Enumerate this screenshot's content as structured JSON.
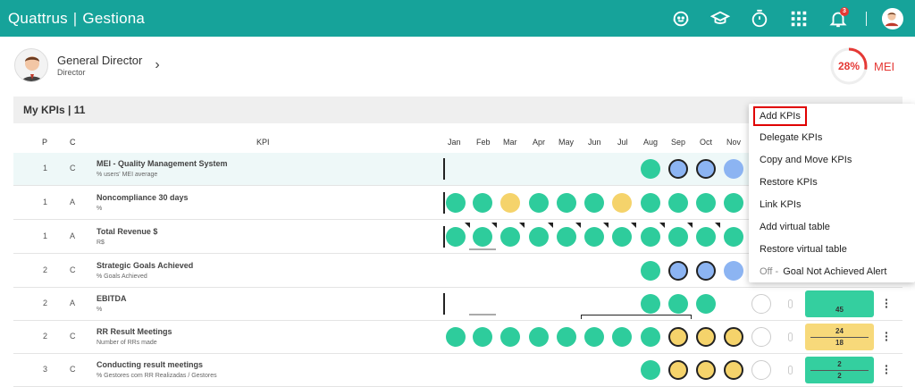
{
  "app": {
    "brand_left": "Quattrus",
    "brand_sep": "|",
    "brand_right": "Gestiona",
    "notification_count": "3"
  },
  "profile": {
    "name": "General Director",
    "role": "Director"
  },
  "mei": {
    "percent": "28%",
    "label": "MEI",
    "value_fraction": 0.28,
    "ring_color": "#e53935"
  },
  "section": {
    "title": "My KPIs | 11"
  },
  "columns": {
    "p": "P",
    "c": "C",
    "kpi": "KPI",
    "months": [
      "Jan",
      "Feb",
      "Mar",
      "Apr",
      "May",
      "Jun",
      "Jul",
      "Aug",
      "Sep",
      "Oct",
      "Nov"
    ]
  },
  "rows": [
    {
      "p": "1",
      "c": "C",
      "name": "MEI - Quality Management System",
      "unit": "% users' MEI average"
    },
    {
      "p": "1",
      "c": "A",
      "name": "Noncompliance 30 days",
      "unit": "%"
    },
    {
      "p": "1",
      "c": "A",
      "name": "Total Revenue $",
      "unit": "R$"
    },
    {
      "p": "2",
      "c": "C",
      "name": "Strategic Goals Achieved",
      "unit": "% Goals Achieved"
    },
    {
      "p": "2",
      "c": "A",
      "name": "EBITDA",
      "unit": "%"
    },
    {
      "p": "2",
      "c": "C",
      "name": "RR Result Meetings",
      "unit": "Number of RRs made"
    },
    {
      "p": "3",
      "c": "C",
      "name": "Conducting result meetings",
      "unit": "% Gestores com RR Realizadas / Gestores"
    }
  ],
  "pills": {
    "ebitda": "45",
    "rr_top": "24",
    "rr_bottom": "18",
    "cond_top": "2",
    "cond_bottom": "2"
  },
  "menu": {
    "items": [
      "Add KPIs",
      "Delegate KPIs",
      "Copy and Move KPIs",
      "Restore KPIs",
      "Link KPIs",
      "Add virtual table",
      "Restore virtual table"
    ],
    "toggle_state": "Off -",
    "toggle_label": "Goal Not Achieved Alert"
  },
  "colors": {
    "topbar": "#16a39a",
    "green": "#2ecc9c",
    "yellow": "#f5d36b",
    "blue": "#8cb4f2",
    "highlight": "#e00000"
  }
}
